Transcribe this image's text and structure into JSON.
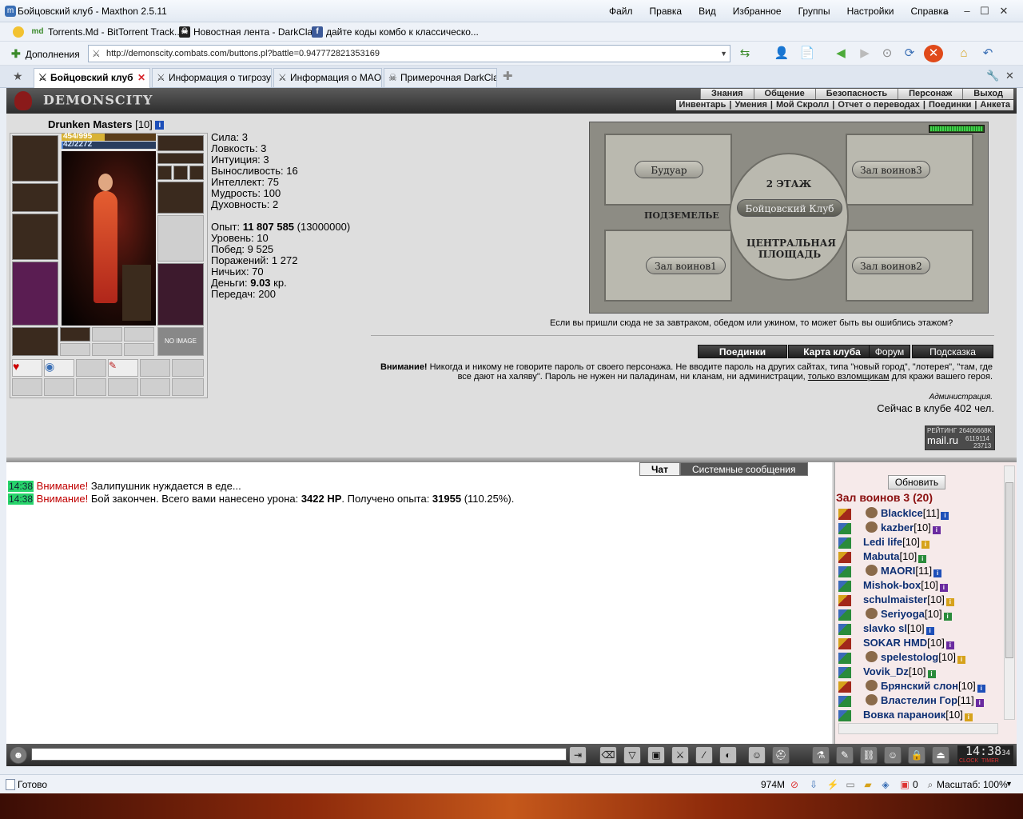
{
  "window": {
    "title": "Бойцовский клуб - Maxthon 2.5.11",
    "menu": [
      "Файл",
      "Правка",
      "Вид",
      "Избранное",
      "Группы",
      "Настройки",
      "Справка"
    ]
  },
  "favorites": [
    {
      "label": "Torrents.Md - BitTorrent Track...",
      "icon": "md"
    },
    {
      "label": "Новостная лента - DarkClan",
      "icon": "dc"
    },
    {
      "label": "дайте коды комбо к классическо...",
      "icon": "f"
    }
  ],
  "addressbar": {
    "addons_label": "Дополнения",
    "url": "http://demonscity.combats.com/buttons.pl?battle=0.947772821353169"
  },
  "tabs": [
    {
      "label": "Бойцовский клуб",
      "active": true
    },
    {
      "label": "Информация о тигрозуб",
      "active": false
    },
    {
      "label": "Информация о MAORI",
      "active": false
    },
    {
      "label": "Примерочная DarkClan",
      "active": false
    }
  ],
  "game": {
    "logo": "DEMONSCITY",
    "nav_top": [
      "Знания",
      "Общение",
      "Безопасность",
      "Персонаж",
      "Выход"
    ],
    "nav_bottom": [
      "Инвентарь",
      "Умения",
      "Мой Скролл",
      "Отчет о переводах",
      "Поединки",
      "Анкета"
    ],
    "character": {
      "name": "Drunken Masters",
      "level": "[10]",
      "hp": "454/995",
      "hp_fraction": 0.456,
      "mp": "42/2272",
      "mp_fraction": 0.018
    },
    "stats": [
      "Сила: 3",
      "Ловкость: 3",
      "Интуиция: 3",
      "Выносливость: 16",
      "Интеллект: 75",
      "Мудрость: 100",
      "Духовность: 2"
    ],
    "experience": {
      "label": "Опыт:",
      "value": "11 807 585",
      "next": "(13000000)"
    },
    "stats2": [
      "Уровень: 10",
      "Побед: 9 525",
      "Поражений: 1 272",
      "Ничьих: 70"
    ],
    "money": {
      "label": "Деньги:",
      "value": "9.03",
      "unit": "кр."
    },
    "transfers": "Передач: 200",
    "map": {
      "rooms": [
        "Будуар",
        "Зал воинов3",
        "ПОДЗЕМЕЛЬЕ",
        "Зал воинов1",
        "Зал воинов2"
      ],
      "floor": "2 ЭТАЖ",
      "center_plate": "Бойцовский Клуб",
      "center_area": "ЦЕНТРАЛЬНАЯ ПЛОЩАДЬ"
    },
    "map_tip": "Если вы пришли сюда не за завтраком, обедом или ужином, то может быть вы ошиблись этажом?",
    "buttons": [
      "Поединки",
      "Карта клуба",
      "Форум",
      "Подсказка"
    ],
    "warning": {
      "title": "Внимание!",
      "text1": " Никогда и никому не говорите пароль от своего персонажа. Не вводите пароль на других сайтах, типа \"новый город\", \"лотерея\", \"там, где все дают на халяву\". Пароль не нужен ни паладинам, ни кланам, ни администрации, ",
      "link": "только взломщикам",
      "text2": " для кражи вашего героя."
    },
    "admin_sign": "Администрация.",
    "online": "Сейчас в клубе 402 чел.",
    "rating": {
      "label": "РЕЙТИНГ",
      "brand": "mail.ru",
      "n1": "26406668K",
      "n2": "6119114",
      "n3": "23713"
    }
  },
  "chat": {
    "tabs": [
      "Чат",
      "Системные сообщения"
    ],
    "lines": [
      {
        "time": "14:38",
        "warn": "Внимание!",
        "text": " Залипушник нуждается в еде..."
      },
      {
        "time": "14:38",
        "warn": "Внимание!",
        "text_a": " Бой закончен. Всего вами нанесено урона: ",
        "dmg": "3422 HP",
        "text_b": ". Получено опыта: ",
        "exp": "31955",
        "text_c": " (110.25%)."
      }
    ]
  },
  "userlist": {
    "refresh": "Обновить",
    "room": "Зал воинов 3 (20)",
    "users": [
      {
        "name": "BlackIce",
        "lvl": "[11]",
        "align": true
      },
      {
        "name": "kazber",
        "lvl": "[10]",
        "align": true
      },
      {
        "name": "Ledi life",
        "lvl": "[10]",
        "align": false
      },
      {
        "name": "Mabuta",
        "lvl": "[10]",
        "align": false
      },
      {
        "name": "MAORI",
        "lvl": "[11]",
        "align": true
      },
      {
        "name": "Mishok-box",
        "lvl": "[10]",
        "align": false
      },
      {
        "name": "schulmaister",
        "lvl": "[10]",
        "align": false
      },
      {
        "name": "Seriyoga",
        "lvl": "[10]",
        "align": true
      },
      {
        "name": "slavko sl",
        "lvl": "[10]",
        "align": false
      },
      {
        "name": "SOKAR HMD",
        "lvl": "[10]",
        "align": false
      },
      {
        "name": "spelestolog",
        "lvl": "[10]",
        "align": true
      },
      {
        "name": "Vovik_Dz",
        "lvl": "[10]",
        "align": false
      },
      {
        "name": "Брянский слон",
        "lvl": "[10]",
        "align": true
      },
      {
        "name": "Властелин Гор",
        "lvl": "[11]",
        "align": true
      },
      {
        "name": "Вовка параноик",
        "lvl": "[10]",
        "align": false
      }
    ]
  },
  "clock": {
    "time": "14:38",
    "sec": "34",
    "clock_lbl": "CLOCK",
    "timer_lbl": "TIMER"
  },
  "statusbar": {
    "status": "Готово",
    "memory": "974M",
    "count": "0",
    "zoom": "Масштаб: 100%"
  }
}
